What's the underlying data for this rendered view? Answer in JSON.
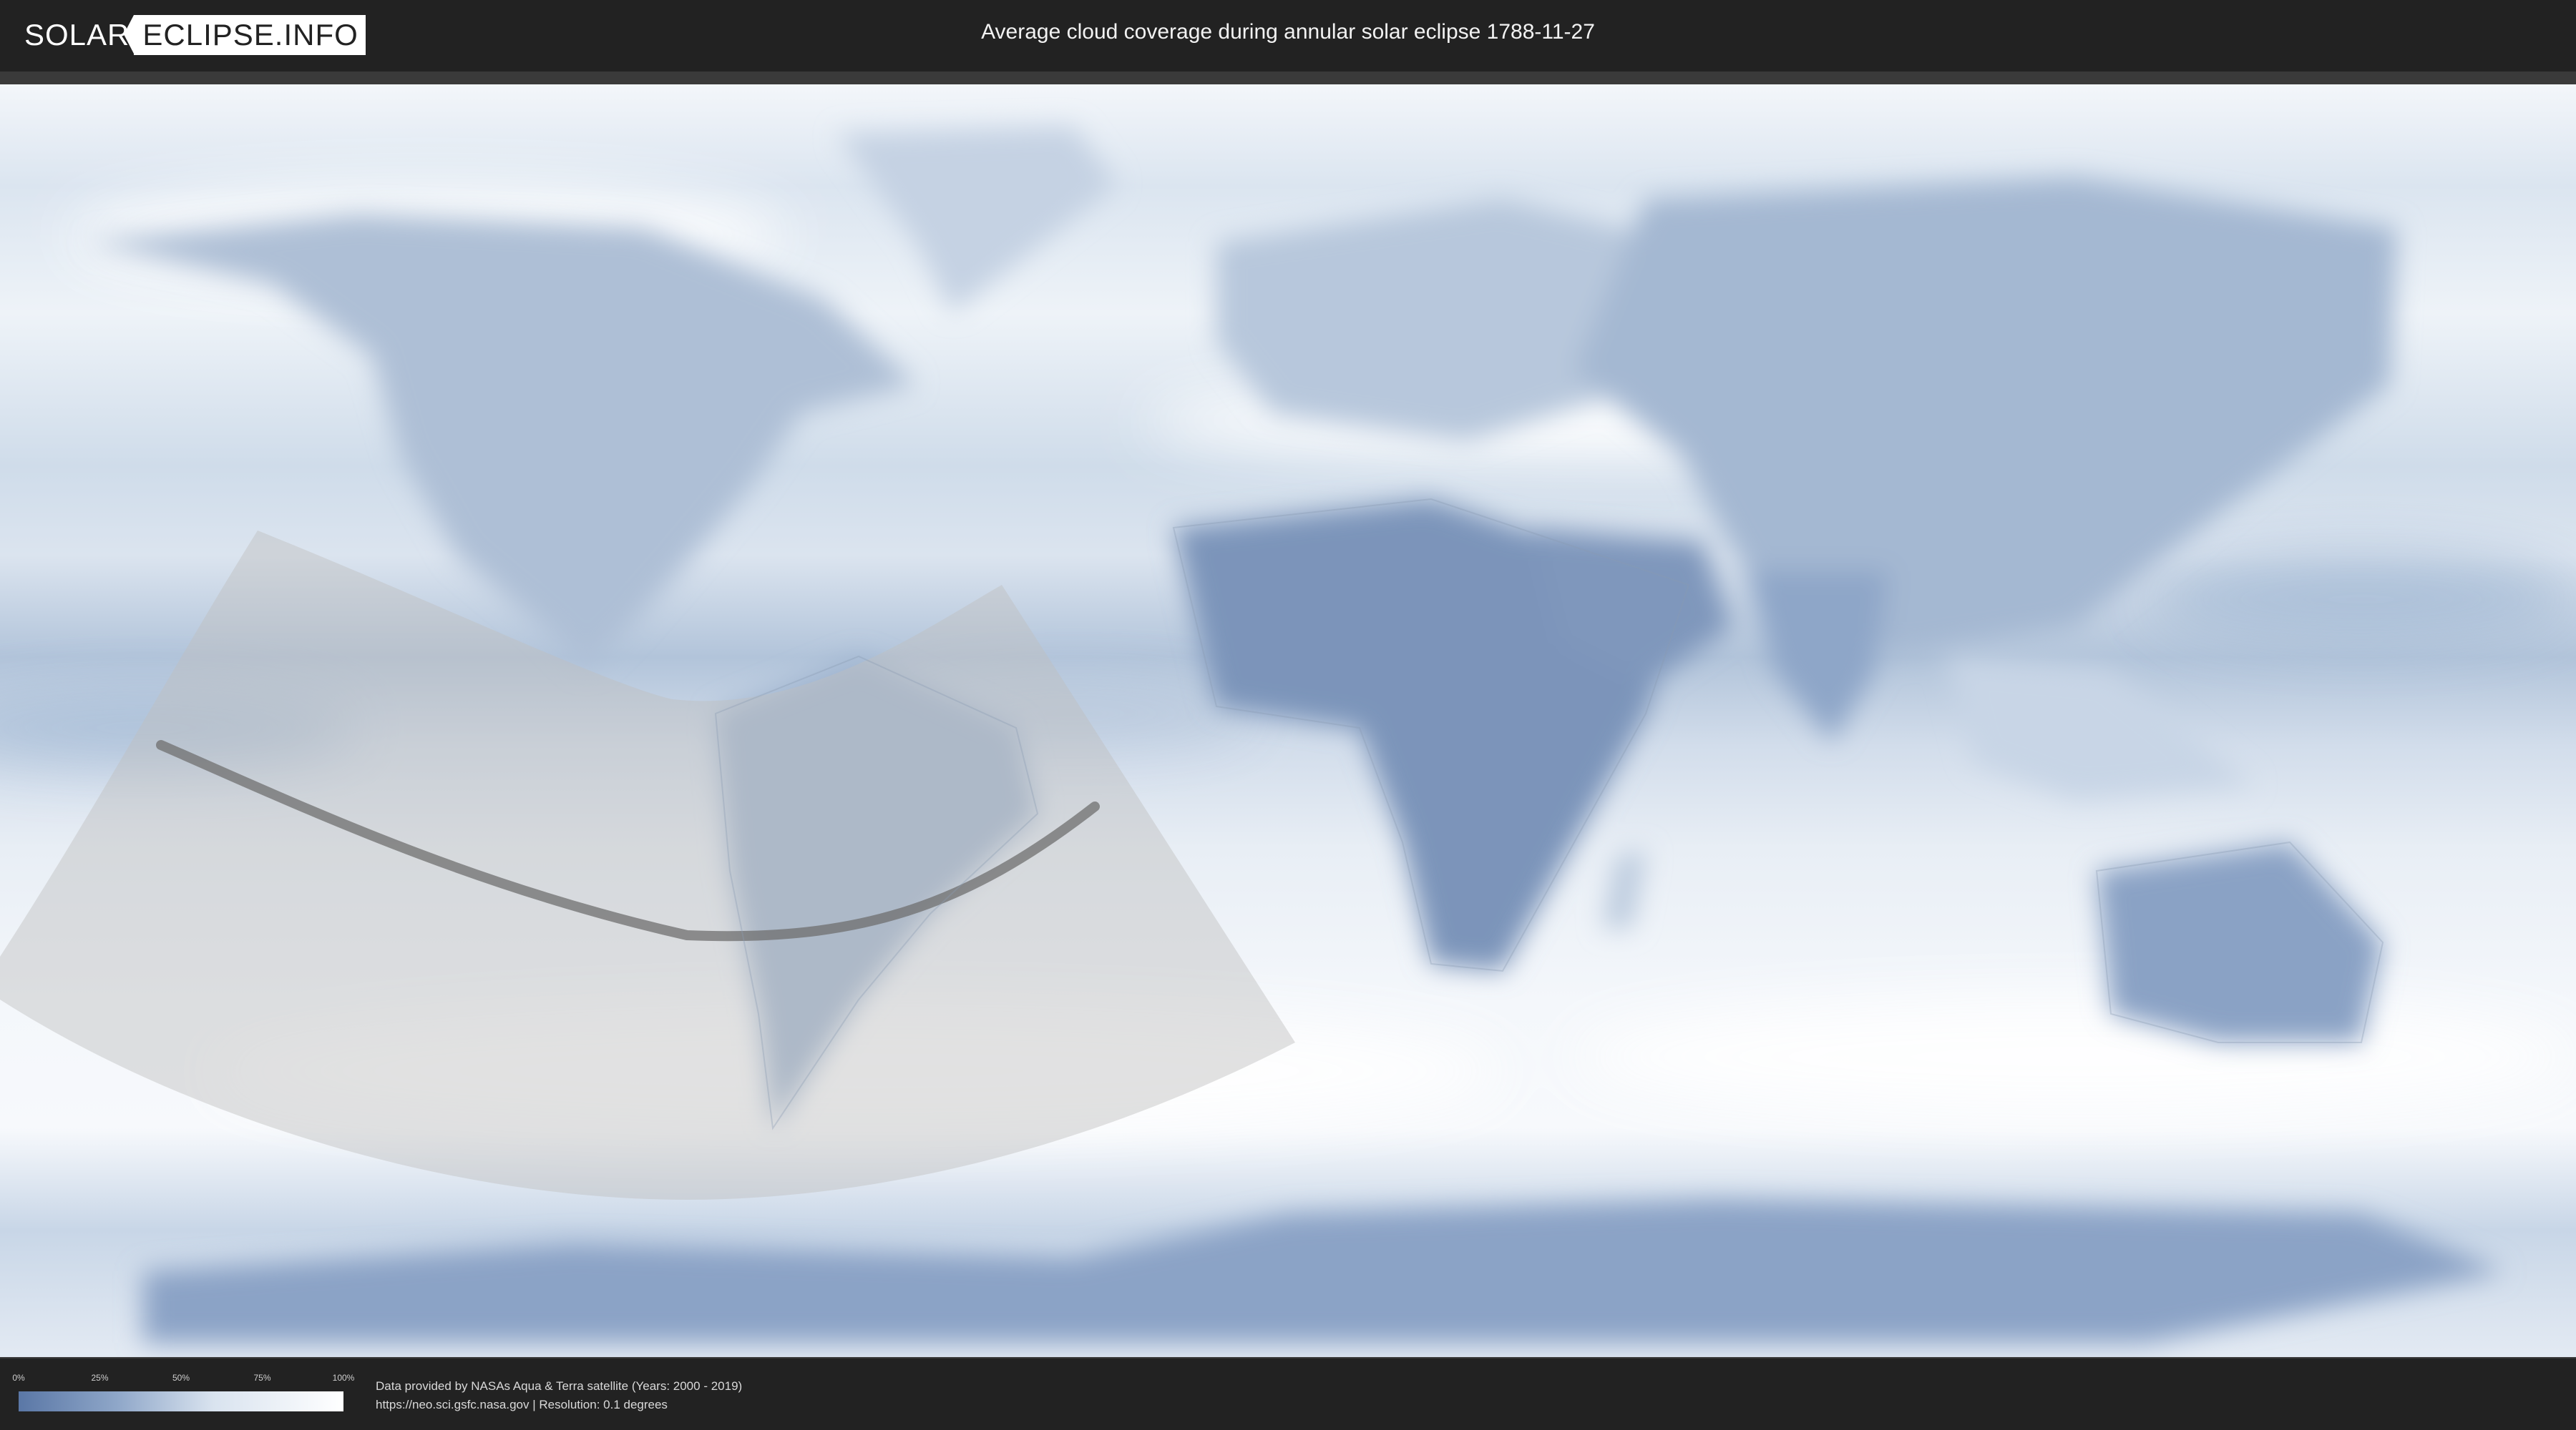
{
  "header": {
    "logo_left": "SOLAR",
    "logo_right": "ECLIPSE.INFO",
    "title": "Average cloud coverage during annular solar eclipse 1788-11-27"
  },
  "map": {
    "projection": "equirectangular",
    "overlay": "eclipse path region with central line",
    "colors": {
      "clear_sky": "#5a77a6",
      "cloudy": "#ffffff",
      "path_zone": "#bfbfbf",
      "central_line": "#6f6f6f",
      "ocean_cloud_base": "#d8e3ef"
    }
  },
  "legend": {
    "ticks": [
      "0%",
      "25%",
      "50%",
      "75%",
      "100%"
    ],
    "gradient": [
      "#5a77a6",
      "#8ea6c8",
      "#d9e3ef",
      "#ffffff"
    ]
  },
  "footer": {
    "credit_line1": "Data provided by NASAs Aqua & Terra satellite (Years: 2000 - 2019)",
    "credit_line2": "https://neo.sci.gsfc.nasa.gov | Resolution: 0.1 degrees"
  }
}
